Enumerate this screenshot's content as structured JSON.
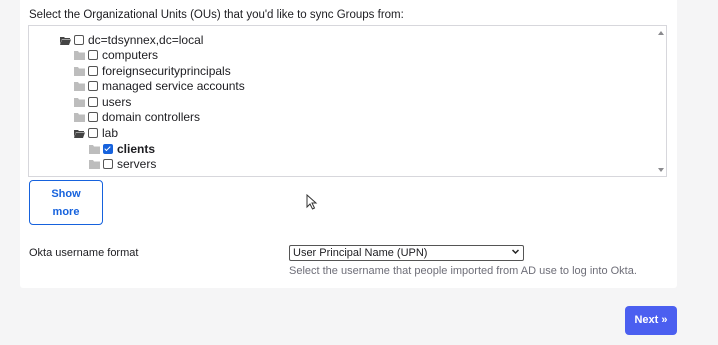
{
  "ou_section": {
    "label": "Select the Organizational Units (OUs) that you'd like to sync Groups from:",
    "tree": [
      {
        "label": "dc=tdsynnex,dc=local",
        "checked": false,
        "folder": "open-folder-icon"
      },
      {
        "label": "computers",
        "checked": false,
        "folder": "closed-folder-icon"
      },
      {
        "label": "foreignsecurityprincipals",
        "checked": false,
        "folder": "closed-folder-icon"
      },
      {
        "label": "managed service accounts",
        "checked": false,
        "folder": "closed-folder-icon"
      },
      {
        "label": "users",
        "checked": false,
        "folder": "closed-folder-icon"
      },
      {
        "label": "domain controllers",
        "checked": false,
        "folder": "closed-folder-icon"
      },
      {
        "label": "lab",
        "checked": false,
        "folder": "open-folder-icon"
      },
      {
        "label": "clients",
        "checked": true,
        "folder": "closed-folder-icon"
      },
      {
        "label": "servers",
        "checked": false,
        "folder": "closed-folder-icon"
      }
    ],
    "show_more_line1": "Show",
    "show_more_line2": "more"
  },
  "username_format": {
    "label": "Okta username format",
    "selected": "User Principal Name (UPN)",
    "help": "Select the username that people imported from AD use to log into Okta."
  },
  "footer": {
    "next_label": "Next »"
  },
  "colors": {
    "accent": "#1662dd",
    "next_button": "#4b5ff0",
    "background": "#f5f5f6",
    "card": "#ffffff"
  }
}
